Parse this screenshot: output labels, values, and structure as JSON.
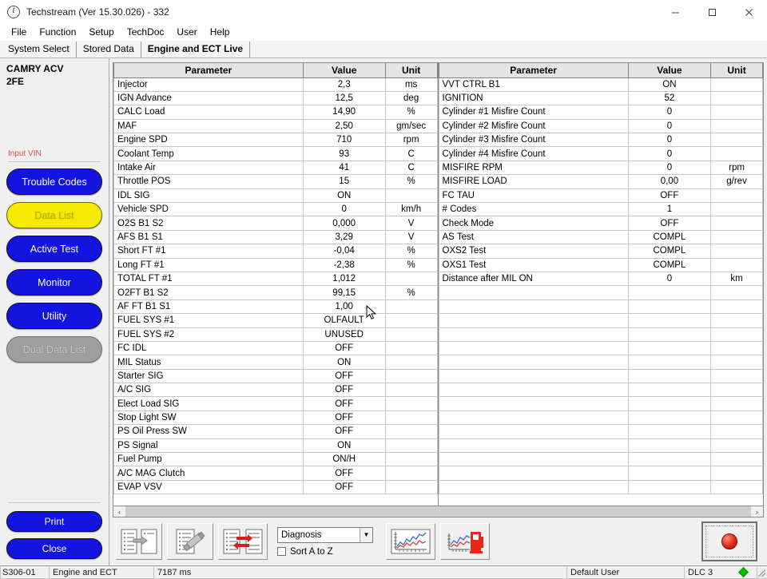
{
  "window": {
    "title": "Techstream (Ver 15.30.026) - 332",
    "app_icon": "techstream-circle-icon",
    "minimize_label": "─",
    "maximize_label": "□",
    "close_label": "✕"
  },
  "menu": {
    "items": [
      {
        "label": "File"
      },
      {
        "label": "Function"
      },
      {
        "label": "Setup"
      },
      {
        "label": "TechDoc"
      },
      {
        "label": "User"
      },
      {
        "label": "Help"
      }
    ]
  },
  "tabs": [
    {
      "label": "System Select",
      "active": false
    },
    {
      "label": "Stored Data",
      "active": false
    },
    {
      "label": "Engine and ECT Live",
      "active": true
    }
  ],
  "sidebar": {
    "vehicle_line1": "CAMRY ACV",
    "vehicle_line2": "2FE",
    "vin_link": "Input VIN",
    "buttons": [
      {
        "label": "Trouble Codes",
        "style": "blue"
      },
      {
        "label": "Data List",
        "style": "yellow"
      },
      {
        "label": "Active Test",
        "style": "blue"
      },
      {
        "label": "Monitor",
        "style": "blue"
      },
      {
        "label": "Utility",
        "style": "blue"
      },
      {
        "label": "Dual Data List",
        "style": "grey"
      }
    ],
    "bottom_buttons": [
      {
        "label": "Print",
        "style": "blue"
      },
      {
        "label": "Close",
        "style": "blue"
      }
    ]
  },
  "table": {
    "headers": {
      "parameter": "Parameter",
      "value": "Value",
      "unit": "Unit"
    },
    "left_rows": [
      {
        "parameter": "Injector",
        "value": "2,3",
        "unit": "ms"
      },
      {
        "parameter": "IGN Advance",
        "value": "12,5",
        "unit": "deg"
      },
      {
        "parameter": "CALC Load",
        "value": "14,90",
        "unit": "%"
      },
      {
        "parameter": "MAF",
        "value": "2,50",
        "unit": "gm/sec"
      },
      {
        "parameter": "Engine SPD",
        "value": "710",
        "unit": "rpm"
      },
      {
        "parameter": "Coolant Temp",
        "value": "93",
        "unit": "C"
      },
      {
        "parameter": "Intake Air",
        "value": "41",
        "unit": "C"
      },
      {
        "parameter": "Throttle POS",
        "value": "15",
        "unit": "%"
      },
      {
        "parameter": "IDL SIG",
        "value": "ON",
        "unit": ""
      },
      {
        "parameter": "Vehicle SPD",
        "value": "0",
        "unit": "km/h"
      },
      {
        "parameter": "O2S B1 S2",
        "value": "0,000",
        "unit": "V"
      },
      {
        "parameter": "AFS B1 S1",
        "value": "3,29",
        "unit": "V"
      },
      {
        "parameter": "Short FT #1",
        "value": "-0,04",
        "unit": "%"
      },
      {
        "parameter": "Long FT #1",
        "value": "-2,38",
        "unit": "%"
      },
      {
        "parameter": "TOTAL FT #1",
        "value": "1,012",
        "unit": ""
      },
      {
        "parameter": "O2FT B1 S2",
        "value": "99,15",
        "unit": "%"
      },
      {
        "parameter": "AF FT B1 S1",
        "value": "1,00",
        "unit": ""
      },
      {
        "parameter": "FUEL SYS #1",
        "value": "OLFAULT",
        "unit": ""
      },
      {
        "parameter": "FUEL SYS #2",
        "value": "UNUSED",
        "unit": ""
      },
      {
        "parameter": "FC IDL",
        "value": "OFF",
        "unit": ""
      },
      {
        "parameter": "MIL Status",
        "value": "ON",
        "unit": ""
      },
      {
        "parameter": "Starter SIG",
        "value": "OFF",
        "unit": ""
      },
      {
        "parameter": "A/C SIG",
        "value": "OFF",
        "unit": ""
      },
      {
        "parameter": "Elect Load SIG",
        "value": "OFF",
        "unit": ""
      },
      {
        "parameter": "Stop Light SW",
        "value": "OFF",
        "unit": ""
      },
      {
        "parameter": "PS Oil Press SW",
        "value": "OFF",
        "unit": ""
      },
      {
        "parameter": "PS Signal",
        "value": "ON",
        "unit": ""
      },
      {
        "parameter": "Fuel Pump",
        "value": "ON/H",
        "unit": ""
      },
      {
        "parameter": "A/C MAG Clutch",
        "value": "OFF",
        "unit": ""
      },
      {
        "parameter": "EVAP VSV",
        "value": "OFF",
        "unit": ""
      }
    ],
    "right_rows": [
      {
        "parameter": "VVT CTRL B1",
        "value": "ON",
        "unit": ""
      },
      {
        "parameter": "IGNITION",
        "value": "52",
        "unit": ""
      },
      {
        "parameter": "Cylinder #1 Misfire Count",
        "value": "0",
        "unit": ""
      },
      {
        "parameter": "Cylinder #2 Misfire Count",
        "value": "0",
        "unit": ""
      },
      {
        "parameter": "Cylinder #3 Misfire Count",
        "value": "0",
        "unit": ""
      },
      {
        "parameter": "Cylinder #4 Misfire Count",
        "value": "0",
        "unit": ""
      },
      {
        "parameter": "MISFIRE RPM",
        "value": "0",
        "unit": "rpm"
      },
      {
        "parameter": "MISFIRE LOAD",
        "value": "0,00",
        "unit": "g/rev"
      },
      {
        "parameter": "FC TAU",
        "value": "OFF",
        "unit": ""
      },
      {
        "parameter": "# Codes",
        "value": "1",
        "unit": ""
      },
      {
        "parameter": "Check Mode",
        "value": "OFF",
        "unit": ""
      },
      {
        "parameter": "AS Test",
        "value": "COMPL",
        "unit": ""
      },
      {
        "parameter": "OXS2 Test",
        "value": "COMPL",
        "unit": ""
      },
      {
        "parameter": "OXS1 Test",
        "value": "COMPL",
        "unit": ""
      },
      {
        "parameter": "Distance after MIL ON",
        "value": "0",
        "unit": "km"
      },
      {
        "parameter": "",
        "value": "",
        "unit": ""
      },
      {
        "parameter": "",
        "value": "",
        "unit": ""
      },
      {
        "parameter": "",
        "value": "",
        "unit": ""
      },
      {
        "parameter": "",
        "value": "",
        "unit": ""
      },
      {
        "parameter": "",
        "value": "",
        "unit": ""
      },
      {
        "parameter": "",
        "value": "",
        "unit": ""
      },
      {
        "parameter": "",
        "value": "",
        "unit": ""
      },
      {
        "parameter": "",
        "value": "",
        "unit": ""
      },
      {
        "parameter": "",
        "value": "",
        "unit": ""
      },
      {
        "parameter": "",
        "value": "",
        "unit": ""
      },
      {
        "parameter": "",
        "value": "",
        "unit": ""
      },
      {
        "parameter": "",
        "value": "",
        "unit": ""
      },
      {
        "parameter": "",
        "value": "",
        "unit": ""
      },
      {
        "parameter": "",
        "value": "",
        "unit": ""
      },
      {
        "parameter": "",
        "value": "",
        "unit": ""
      }
    ]
  },
  "scrollbar": {
    "left_arrow": "‹",
    "right_arrow": "›"
  },
  "toolbar": {
    "select_items_icon": "select-items-icon",
    "edit_list_icon": "edit-list-icon",
    "swap_list_icon": "swap-list-icon",
    "graph_icon": "graph-icon",
    "fuel_graph_icon": "fuel-graph-icon",
    "record_icon": "record-dot-icon",
    "dropdown_value": "Diagnosis",
    "dropdown_arrow": "▼",
    "sort_label": "Sort A to Z",
    "sort_checked": false
  },
  "statusbar": {
    "code": "S306-01",
    "system": "Engine and ECT",
    "timing": "7187 ms",
    "user": "Default User",
    "dlc": "DLC 3",
    "dlc_indicator_color": "#00c000"
  }
}
